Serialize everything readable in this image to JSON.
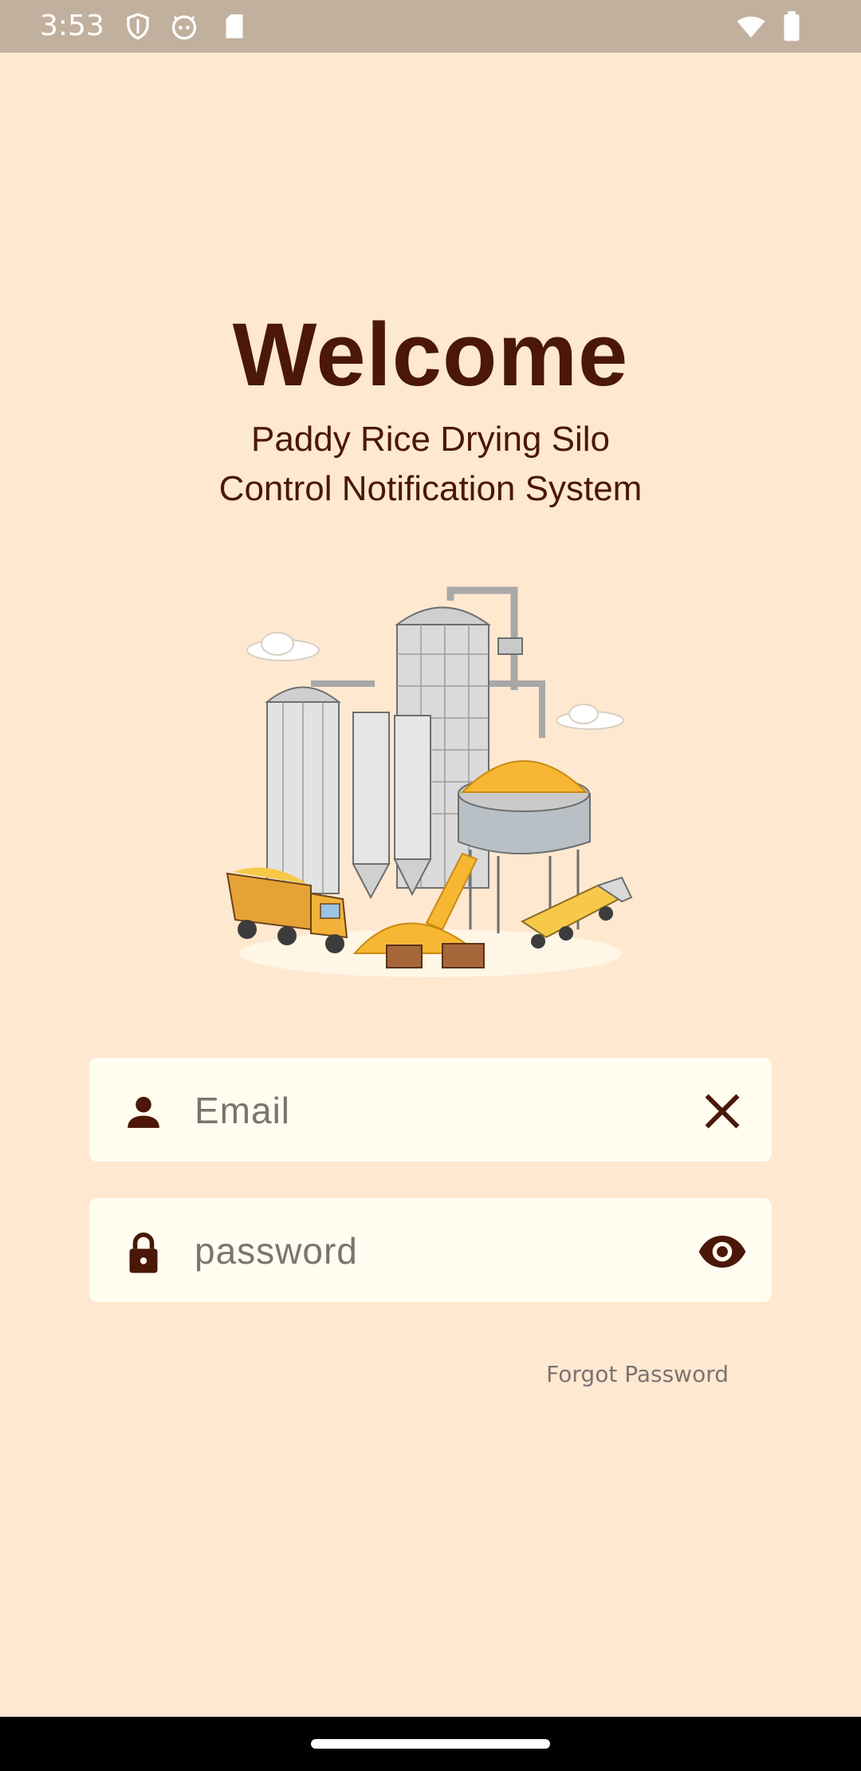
{
  "status_bar": {
    "time": "3:53",
    "left_icons": [
      "shield-icon",
      "android-robot-icon",
      "sd-card-icon"
    ],
    "right_icons": [
      "wifi-icon",
      "battery-icon"
    ]
  },
  "header": {
    "title": "Welcome",
    "subtitle_line1": "Paddy Rice Drying Silo",
    "subtitle_line2": "Control Notification System"
  },
  "illustration": {
    "icon": "rice-silo-illustration"
  },
  "form": {
    "email": {
      "placeholder": "Email",
      "value": "",
      "icon": "person-icon",
      "action_icon": "clear-icon"
    },
    "password": {
      "placeholder": "password",
      "value": "",
      "icon": "lock-icon",
      "action_icon": "eye-icon"
    },
    "forgot_label": "Forgot Password"
  },
  "colors": {
    "background": "#FFE8D0",
    "status_bar": "#C2B09E",
    "text_brown": "#4A1708",
    "field_bg": "#FFFDF0",
    "grain_gold": "#F7B733"
  }
}
